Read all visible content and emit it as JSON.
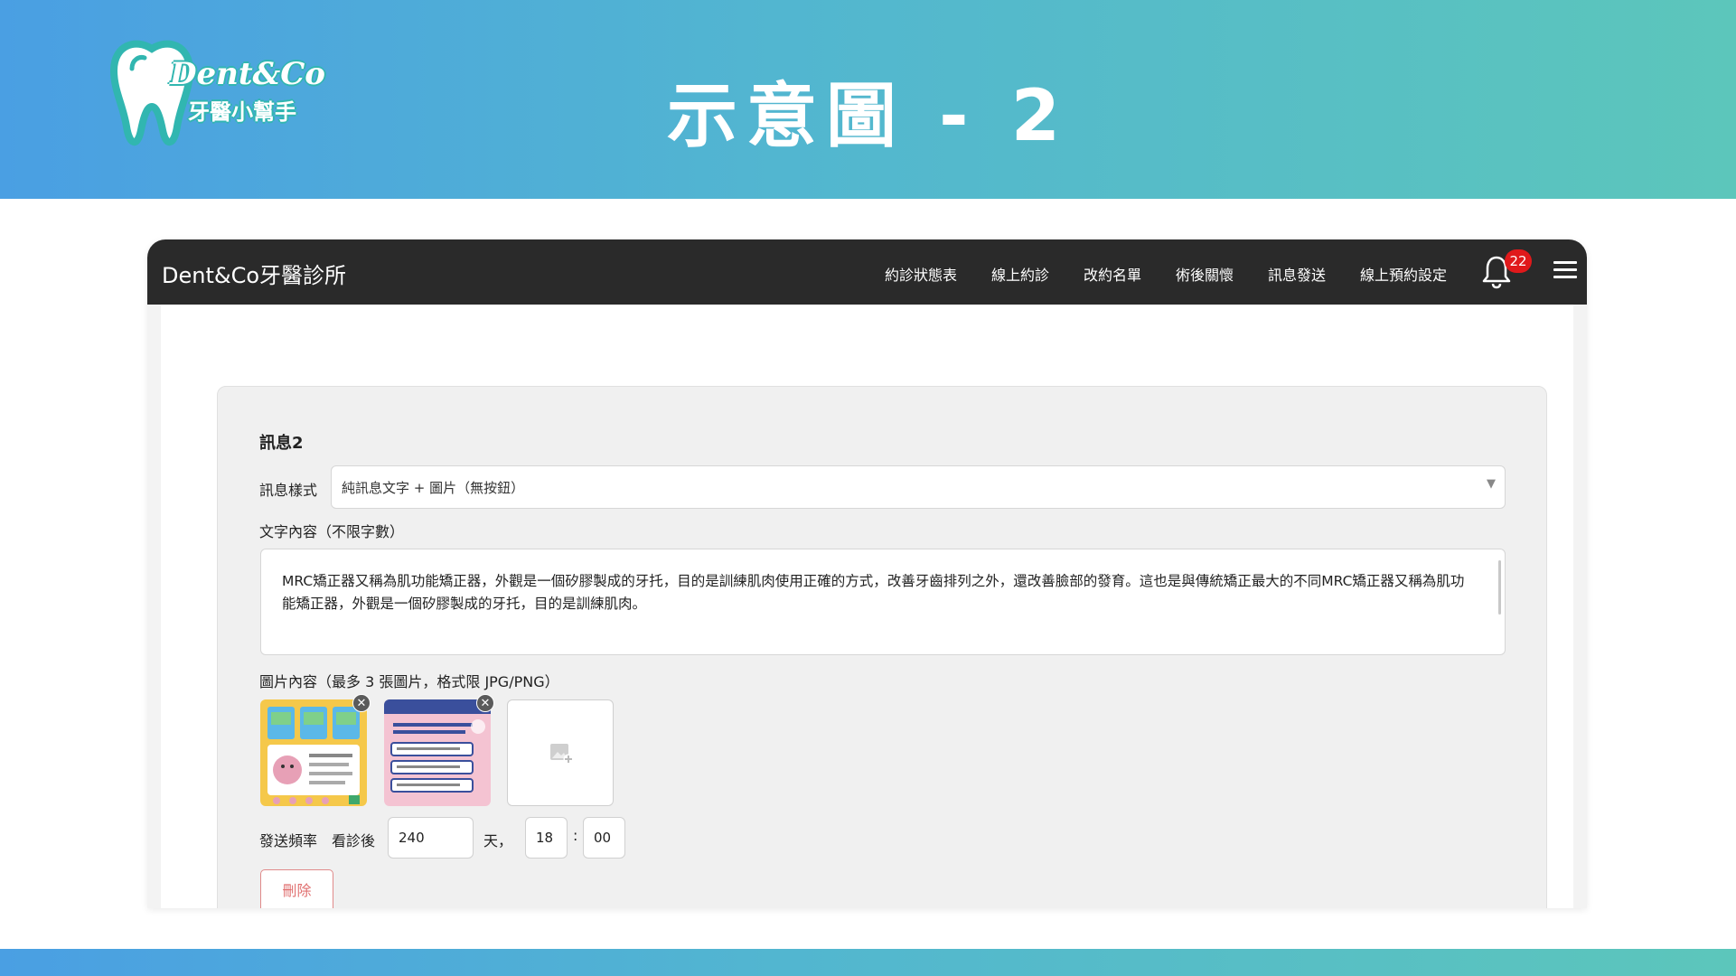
{
  "slide": {
    "title": "示意圖 - 2",
    "logo": {
      "name": "Dent&Co",
      "subtitle": "牙醫小幫手"
    }
  },
  "navbar": {
    "brand": "Dent&Co牙醫診所",
    "items": [
      "約診狀態表",
      "線上約診",
      "改約名單",
      "術後關懷",
      "訊息發送",
      "線上預約設定"
    ],
    "notification_count": "22",
    "icons": [
      "bell-icon",
      "hamburger-menu-icon"
    ]
  },
  "message": {
    "title": "訊息2",
    "style_label": "訊息樣式",
    "style_value": "純訊息文字 + 圖片（無按鈕）",
    "text_label": "文字內容（不限字數）",
    "text_value": "MRC矯正器又稱為肌功能矯正器，外觀是一個矽膠製成的牙托，目的是訓練肌肉使用正確的方式，改善牙齒排列之外，還改善臉部的發育。這也是與傳統矯正最大的不同MRC矯正器又稱為肌功能矯正器，外觀是一個矽膠製成的牙托，目的是訓練肌肉。",
    "image_label": "圖片內容（最多 3 張圖片，格式限 JPG/PNG）",
    "images": [
      {
        "name": "thumbnail-1",
        "accent": "#f5c84a"
      },
      {
        "name": "thumbnail-2",
        "accent": "#f4b8c9"
      }
    ],
    "frequency": {
      "label": "發送頻率",
      "after_label": "看診後",
      "days_value": "240",
      "days_unit": "天，",
      "hour_value": "18",
      "separator": ":",
      "minute_value": "00"
    },
    "delete_label": "刪除"
  },
  "colors": {
    "banner_start": "#4a9fe3",
    "banner_end": "#5cc6bb",
    "navbar": "#2a2a2a",
    "badge": "#e0191b",
    "delete_border": "#e08a8a"
  }
}
